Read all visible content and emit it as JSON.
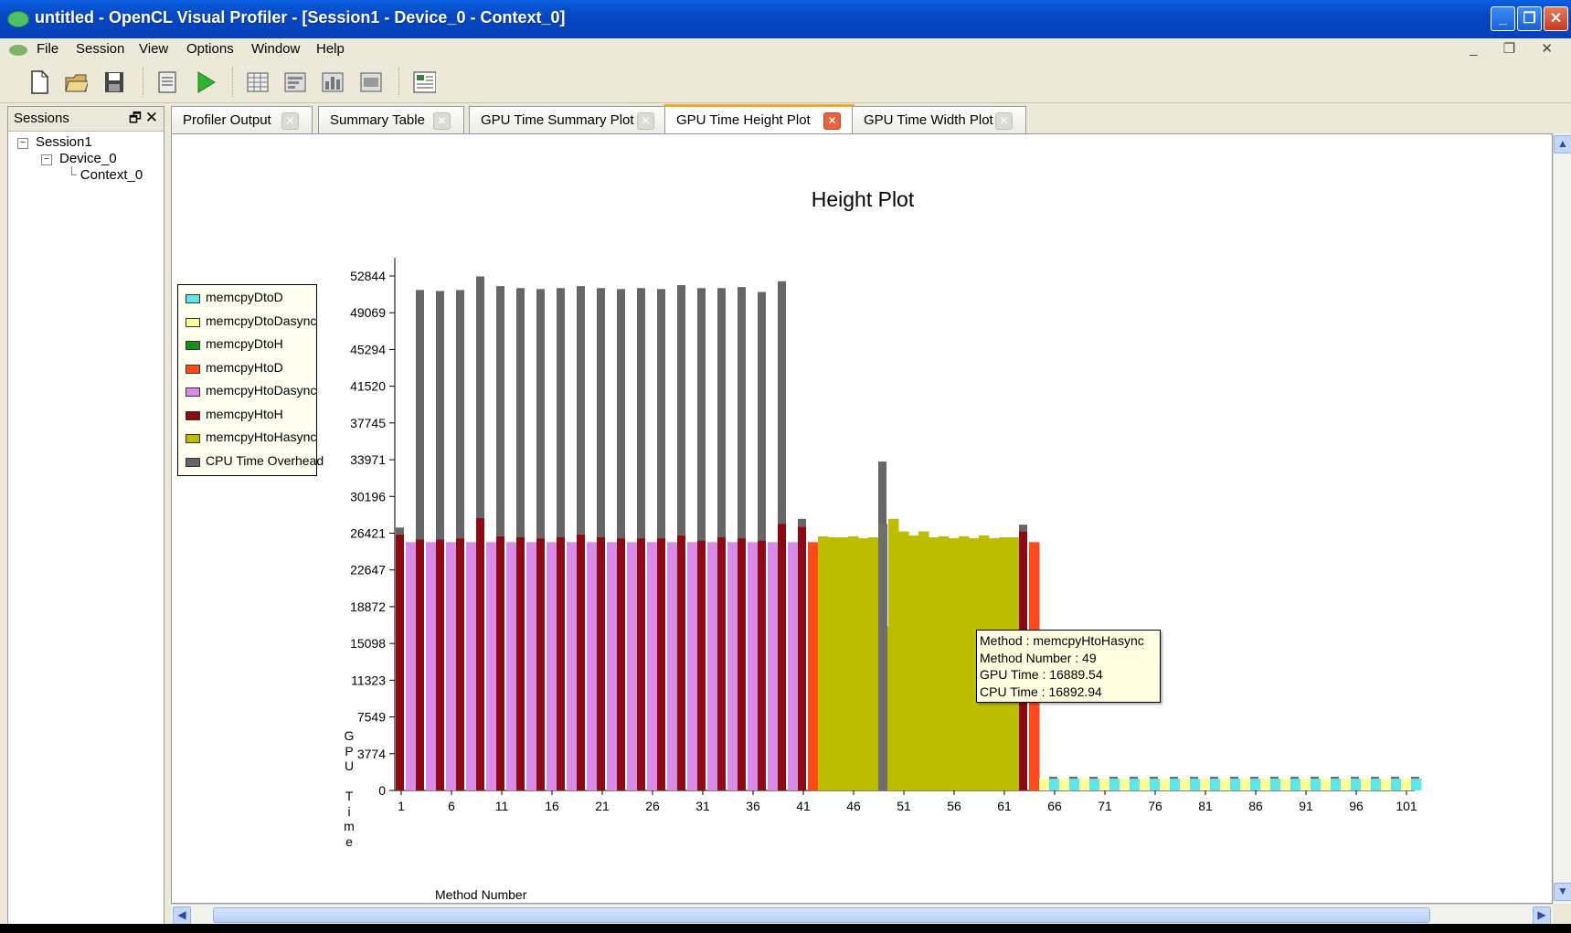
{
  "window": {
    "title": "untitled - OpenCL Visual Profiler - [Session1 - Device_0 - Context_0]",
    "min_label": "_",
    "max_label": "❐",
    "close_label": "✕"
  },
  "menu": {
    "items": [
      "File",
      "Session",
      "View",
      "Options",
      "Window",
      "Help"
    ],
    "mdi_controls": "_ ❐ ✕"
  },
  "toolbar": {
    "icons": [
      "new-file-icon",
      "open-folder-icon",
      "save-icon",
      "session-settings-icon",
      "run-icon",
      "summary-table-icon",
      "gpu-time-summary-icon",
      "height-plot-icon",
      "width-plot-icon",
      "detail-view-icon"
    ]
  },
  "sessions": {
    "title": "Sessions",
    "tree": [
      {
        "label": "Session1",
        "expander": "−"
      },
      {
        "label": "Device_0",
        "expander": "−"
      },
      {
        "label": "Context_0"
      }
    ]
  },
  "tabs": [
    {
      "label": "Profiler Output",
      "active": false
    },
    {
      "label": "Summary Table",
      "active": false
    },
    {
      "label": "GPU Time Summary Plot",
      "active": false
    },
    {
      "label": "GPU Time Height Plot",
      "active": true
    },
    {
      "label": "GPU Time Width Plot",
      "active": false
    }
  ],
  "tab_close_label": "✕",
  "colors": {
    "memcpyDtoD": "#5fe6e6",
    "memcpyDtoDasync": "#ffff99",
    "memcpyDtoH": "#1a8c1a",
    "memcpyHtoD": "#ff4a1a",
    "memcpyHtoDasync": "#d98be8",
    "memcpyHtoH": "#8b0a14",
    "memcpyHtoHasync": "#bdbd00",
    "cpu": "#666666"
  },
  "legend": [
    {
      "label": "memcpyDtoD",
      "color": "#5fe6e6"
    },
    {
      "label": "memcpyDtoDasync",
      "color": "#ffff99"
    },
    {
      "label": "memcpyDtoH",
      "color": "#1a8c1a"
    },
    {
      "label": "memcpyHtoD",
      "color": "#ff4a1a"
    },
    {
      "label": "memcpyHtoDasync",
      "color": "#d98be8"
    },
    {
      "label": "memcpyHtoH",
      "color": "#8b0a14"
    },
    {
      "label": "memcpyHtoHasync",
      "color": "#bdbd00"
    },
    {
      "label": "CPU Time Overhead",
      "color": "#666666"
    }
  ],
  "tooltip": {
    "lines": [
      "Method : memcpyHtoHasync",
      "Method Number : 49",
      "GPU Time : 16889.54",
      "CPU Time : 16892.94"
    ]
  },
  "chart_data": {
    "type": "bar",
    "title": "Height Plot",
    "xlabel": "Method Number",
    "ylabel": "GPU Time",
    "ylim": [
      0,
      52844
    ],
    "y_ticks": [
      "52844",
      "49069",
      "45294",
      "41520",
      "37745",
      "33971",
      "30196",
      "26421",
      "22647",
      "18872",
      "15098",
      "11323",
      "7549",
      "3774",
      "0"
    ],
    "x_ticks": [
      "1",
      "6",
      "11",
      "16",
      "21",
      "26",
      "31",
      "36",
      "41",
      "46",
      "51",
      "56",
      "61",
      "66",
      "71",
      "76",
      "81",
      "86",
      "91",
      "96",
      "101"
    ],
    "x_range": [
      1,
      103
    ],
    "stacked": true,
    "methods": [
      {
        "n": 1,
        "type": "memcpyHtoH",
        "gpu": 26300,
        "cpu": 700
      },
      {
        "n": 2,
        "type": "memcpyHtoDasync",
        "gpu": 25500,
        "cpu": 0
      },
      {
        "n": 3,
        "type": "memcpyHtoH",
        "gpu": 25800,
        "cpu": 25600
      },
      {
        "n": 4,
        "type": "memcpyHtoDasync",
        "gpu": 25500,
        "cpu": 0
      },
      {
        "n": 5,
        "type": "memcpyHtoH",
        "gpu": 25800,
        "cpu": 25500
      },
      {
        "n": 6,
        "type": "memcpyHtoDasync",
        "gpu": 25500,
        "cpu": 0
      },
      {
        "n": 7,
        "type": "memcpyHtoH",
        "gpu": 25900,
        "cpu": 25500
      },
      {
        "n": 8,
        "type": "memcpyHtoDasync",
        "gpu": 25500,
        "cpu": 0
      },
      {
        "n": 9,
        "type": "memcpyHtoH",
        "gpu": 28000,
        "cpu": 24800
      },
      {
        "n": 10,
        "type": "memcpyHtoDasync",
        "gpu": 25500,
        "cpu": 0
      },
      {
        "n": 11,
        "type": "memcpyHtoH",
        "gpu": 26100,
        "cpu": 25700
      },
      {
        "n": 12,
        "type": "memcpyHtoDasync",
        "gpu": 25500,
        "cpu": 0
      },
      {
        "n": 13,
        "type": "memcpyHtoH",
        "gpu": 26000,
        "cpu": 25600
      },
      {
        "n": 14,
        "type": "memcpyHtoDasync",
        "gpu": 25500,
        "cpu": 0
      },
      {
        "n": 15,
        "type": "memcpyHtoH",
        "gpu": 25900,
        "cpu": 25600
      },
      {
        "n": 16,
        "type": "memcpyHtoDasync",
        "gpu": 25500,
        "cpu": 0
      },
      {
        "n": 17,
        "type": "memcpyHtoH",
        "gpu": 26000,
        "cpu": 25600
      },
      {
        "n": 18,
        "type": "memcpyHtoDasync",
        "gpu": 25500,
        "cpu": 0
      },
      {
        "n": 19,
        "type": "memcpyHtoH",
        "gpu": 26300,
        "cpu": 25500
      },
      {
        "n": 20,
        "type": "memcpyHtoDasync",
        "gpu": 25500,
        "cpu": 0
      },
      {
        "n": 21,
        "type": "memcpyHtoH",
        "gpu": 26000,
        "cpu": 25600
      },
      {
        "n": 22,
        "type": "memcpyHtoDasync",
        "gpu": 25500,
        "cpu": 0
      },
      {
        "n": 23,
        "type": "memcpyHtoH",
        "gpu": 25900,
        "cpu": 25600
      },
      {
        "n": 24,
        "type": "memcpyHtoDasync",
        "gpu": 25500,
        "cpu": 0
      },
      {
        "n": 25,
        "type": "memcpyHtoH",
        "gpu": 25900,
        "cpu": 25700
      },
      {
        "n": 26,
        "type": "memcpyHtoDasync",
        "gpu": 25500,
        "cpu": 0
      },
      {
        "n": 27,
        "type": "memcpyHtoH",
        "gpu": 25900,
        "cpu": 25600
      },
      {
        "n": 28,
        "type": "memcpyHtoDasync",
        "gpu": 25500,
        "cpu": 0
      },
      {
        "n": 29,
        "type": "memcpyHtoH",
        "gpu": 26200,
        "cpu": 25700
      },
      {
        "n": 30,
        "type": "memcpyHtoDasync",
        "gpu": 25500,
        "cpu": 0
      },
      {
        "n": 31,
        "type": "memcpyHtoH",
        "gpu": 25700,
        "cpu": 25900
      },
      {
        "n": 32,
        "type": "memcpyHtoDasync",
        "gpu": 25500,
        "cpu": 0
      },
      {
        "n": 33,
        "type": "memcpyHtoH",
        "gpu": 26000,
        "cpu": 25600
      },
      {
        "n": 34,
        "type": "memcpyHtoDasync",
        "gpu": 25500,
        "cpu": 0
      },
      {
        "n": 35,
        "type": "memcpyHtoH",
        "gpu": 25900,
        "cpu": 25800
      },
      {
        "n": 36,
        "type": "memcpyHtoDasync",
        "gpu": 25500,
        "cpu": 0
      },
      {
        "n": 37,
        "type": "memcpyHtoH",
        "gpu": 25700,
        "cpu": 25500
      },
      {
        "n": 38,
        "type": "memcpyHtoDasync",
        "gpu": 25500,
        "cpu": 0
      },
      {
        "n": 39,
        "type": "memcpyHtoH",
        "gpu": 27400,
        "cpu": 24900
      },
      {
        "n": 40,
        "type": "memcpyHtoDasync",
        "gpu": 25500,
        "cpu": 0
      },
      {
        "n": 41,
        "type": "memcpyHtoH",
        "gpu": 27100,
        "cpu": 800
      },
      {
        "n": 42,
        "type": "memcpyHtoD",
        "gpu": 25500,
        "cpu": 0
      },
      {
        "n": 43,
        "type": "memcpyHtoHasync",
        "gpu": 26100,
        "cpu": 0
      },
      {
        "n": 44,
        "type": "memcpyHtoHasync",
        "gpu": 26000,
        "cpu": 0
      },
      {
        "n": 45,
        "type": "memcpyHtoHasync",
        "gpu": 26000,
        "cpu": 0
      },
      {
        "n": 46,
        "type": "memcpyHtoHasync",
        "gpu": 26100,
        "cpu": 0
      },
      {
        "n": 47,
        "type": "memcpyHtoHasync",
        "gpu": 25900,
        "cpu": 0
      },
      {
        "n": 48,
        "type": "memcpyHtoHasync",
        "gpu": 26000,
        "cpu": 0
      },
      {
        "n": 49,
        "type": "memcpyHtoHasync",
        "gpu": 16889.54,
        "cpu": 16892.94
      },
      {
        "n": 50,
        "type": "memcpyHtoHasync",
        "gpu": 27900,
        "cpu": 0
      },
      {
        "n": 51,
        "type": "memcpyHtoHasync",
        "gpu": 26600,
        "cpu": 0
      },
      {
        "n": 52,
        "type": "memcpyHtoHasync",
        "gpu": 26200,
        "cpu": 0
      },
      {
        "n": 53,
        "type": "memcpyHtoHasync",
        "gpu": 26600,
        "cpu": 0
      },
      {
        "n": 54,
        "type": "memcpyHtoHasync",
        "gpu": 26000,
        "cpu": 0
      },
      {
        "n": 55,
        "type": "memcpyHtoHasync",
        "gpu": 26100,
        "cpu": 0
      },
      {
        "n": 56,
        "type": "memcpyHtoHasync",
        "gpu": 25900,
        "cpu": 0
      },
      {
        "n": 57,
        "type": "memcpyHtoHasync",
        "gpu": 26100,
        "cpu": 0
      },
      {
        "n": 58,
        "type": "memcpyHtoHasync",
        "gpu": 25900,
        "cpu": 0
      },
      {
        "n": 59,
        "type": "memcpyHtoHasync",
        "gpu": 26200,
        "cpu": 0
      },
      {
        "n": 60,
        "type": "memcpyHtoHasync",
        "gpu": 25900,
        "cpu": 0
      },
      {
        "n": 61,
        "type": "memcpyHtoHasync",
        "gpu": 26000,
        "cpu": 0
      },
      {
        "n": 62,
        "type": "memcpyHtoHasync",
        "gpu": 26000,
        "cpu": 0
      },
      {
        "n": 63,
        "type": "memcpyHtoH",
        "gpu": 26600,
        "cpu": 700
      },
      {
        "n": 64,
        "type": "memcpyHtoD",
        "gpu": 25500,
        "cpu": 0
      },
      {
        "n": 65,
        "type": "memcpyDtoDasync",
        "gpu": 1200,
        "cpu": 0
      },
      {
        "n": 66,
        "type": "memcpyDtoD",
        "gpu": 1200,
        "cpu": 200
      },
      {
        "n": 67,
        "type": "memcpyDtoDasync",
        "gpu": 1200,
        "cpu": 0
      },
      {
        "n": 68,
        "type": "memcpyDtoD",
        "gpu": 1200,
        "cpu": 200
      },
      {
        "n": 69,
        "type": "memcpyDtoDasync",
        "gpu": 1200,
        "cpu": 0
      },
      {
        "n": 70,
        "type": "memcpyDtoD",
        "gpu": 1200,
        "cpu": 200
      },
      {
        "n": 71,
        "type": "memcpyDtoDasync",
        "gpu": 1200,
        "cpu": 0
      },
      {
        "n": 72,
        "type": "memcpyDtoD",
        "gpu": 1200,
        "cpu": 200
      },
      {
        "n": 73,
        "type": "memcpyDtoDasync",
        "gpu": 1200,
        "cpu": 0
      },
      {
        "n": 74,
        "type": "memcpyDtoD",
        "gpu": 1200,
        "cpu": 200
      },
      {
        "n": 75,
        "type": "memcpyDtoDasync",
        "gpu": 1200,
        "cpu": 0
      },
      {
        "n": 76,
        "type": "memcpyDtoD",
        "gpu": 1200,
        "cpu": 200
      },
      {
        "n": 77,
        "type": "memcpyDtoDasync",
        "gpu": 1200,
        "cpu": 0
      },
      {
        "n": 78,
        "type": "memcpyDtoD",
        "gpu": 1200,
        "cpu": 200
      },
      {
        "n": 79,
        "type": "memcpyDtoDasync",
        "gpu": 1200,
        "cpu": 0
      },
      {
        "n": 80,
        "type": "memcpyDtoD",
        "gpu": 1200,
        "cpu": 200
      },
      {
        "n": 81,
        "type": "memcpyDtoDasync",
        "gpu": 1200,
        "cpu": 0
      },
      {
        "n": 82,
        "type": "memcpyDtoD",
        "gpu": 1200,
        "cpu": 200
      },
      {
        "n": 83,
        "type": "memcpyDtoDasync",
        "gpu": 1200,
        "cpu": 0
      },
      {
        "n": 84,
        "type": "memcpyDtoD",
        "gpu": 1200,
        "cpu": 200
      },
      {
        "n": 85,
        "type": "memcpyDtoDasync",
        "gpu": 1200,
        "cpu": 0
      },
      {
        "n": 86,
        "type": "memcpyDtoD",
        "gpu": 1200,
        "cpu": 200
      },
      {
        "n": 87,
        "type": "memcpyDtoDasync",
        "gpu": 1200,
        "cpu": 0
      },
      {
        "n": 88,
        "type": "memcpyDtoD",
        "gpu": 1200,
        "cpu": 200
      },
      {
        "n": 89,
        "type": "memcpyDtoDasync",
        "gpu": 1200,
        "cpu": 0
      },
      {
        "n": 90,
        "type": "memcpyDtoD",
        "gpu": 1200,
        "cpu": 200
      },
      {
        "n": 91,
        "type": "memcpyDtoDasync",
        "gpu": 1200,
        "cpu": 0
      },
      {
        "n": 92,
        "type": "memcpyDtoD",
        "gpu": 1200,
        "cpu": 200
      },
      {
        "n": 93,
        "type": "memcpyDtoDasync",
        "gpu": 1200,
        "cpu": 0
      },
      {
        "n": 94,
        "type": "memcpyDtoD",
        "gpu": 1200,
        "cpu": 200
      },
      {
        "n": 95,
        "type": "memcpyDtoDasync",
        "gpu": 1200,
        "cpu": 0
      },
      {
        "n": 96,
        "type": "memcpyDtoD",
        "gpu": 1200,
        "cpu": 200
      },
      {
        "n": 97,
        "type": "memcpyDtoDasync",
        "gpu": 1200,
        "cpu": 0
      },
      {
        "n": 98,
        "type": "memcpyDtoD",
        "gpu": 1200,
        "cpu": 200
      },
      {
        "n": 99,
        "type": "memcpyDtoDasync",
        "gpu": 1200,
        "cpu": 0
      },
      {
        "n": 100,
        "type": "memcpyDtoD",
        "gpu": 1200,
        "cpu": 200
      },
      {
        "n": 101,
        "type": "memcpyDtoDasync",
        "gpu": 1200,
        "cpu": 0
      },
      {
        "n": 102,
        "type": "memcpyDtoD",
        "gpu": 1200,
        "cpu": 200
      }
    ]
  }
}
